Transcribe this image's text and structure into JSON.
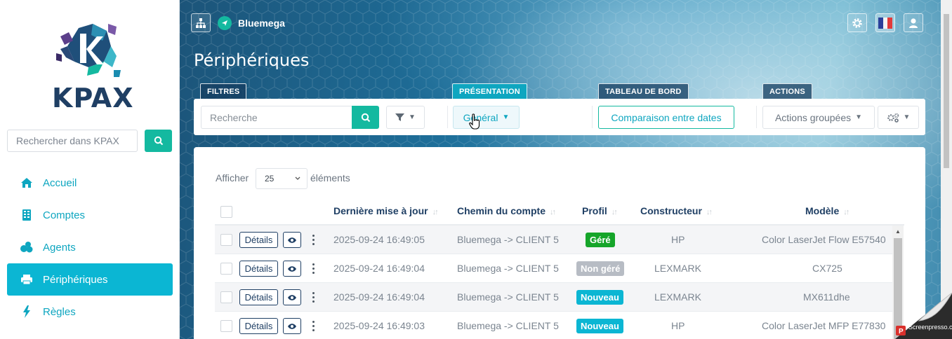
{
  "sidebar": {
    "logo_text": "KPAX",
    "search_placeholder": "Rechercher dans KPAX",
    "items": [
      {
        "label": "Accueil",
        "icon": "home-icon"
      },
      {
        "label": "Comptes",
        "icon": "building-icon"
      },
      {
        "label": "Agents",
        "icon": "agents-icon"
      },
      {
        "label": "Périphériques",
        "icon": "printer-icon",
        "active": true
      },
      {
        "label": "Règles",
        "icon": "bolt-icon"
      }
    ]
  },
  "header": {
    "brand": "Bluemega",
    "title": "Périphériques"
  },
  "sections": {
    "filters": "FILTRES",
    "presentation": "PRÉSENTATION",
    "dashboard": "TABLEAU DE BORD",
    "actions": "ACTIONS"
  },
  "toolbar": {
    "search_placeholder": "Recherche",
    "general_label": "Général",
    "compare_label": "Comparaison entre dates",
    "group_actions_label": "Actions groupées"
  },
  "table": {
    "show_label": "Afficher",
    "page_size": "25",
    "elements_label": "éléments",
    "columns": [
      "Dernière mise à jour",
      "Chemin du compte",
      "Profil",
      "Constructeur",
      "Modèle"
    ],
    "details_label": "Détails",
    "rows": [
      {
        "date": "2025-09-24 16:49:05",
        "path": "Bluemega -> CLIENT 5",
        "profile": "Géré",
        "profile_color": "#16a52a",
        "maker": "HP",
        "model": "Color LaserJet Flow E57540"
      },
      {
        "date": "2025-09-24 16:49:04",
        "path": "Bluemega -> CLIENT 5",
        "profile": "Non géré",
        "profile_color": "#b7bcc4",
        "maker": "LEXMARK",
        "model": "CX725"
      },
      {
        "date": "2025-09-24 16:49:04",
        "path": "Bluemega -> CLIENT 5",
        "profile": "Nouveau",
        "profile_color": "#0bb6d3",
        "maker": "LEXMARK",
        "model": "MX611dhe"
      },
      {
        "date": "2025-09-24 16:49:03",
        "path": "Bluemega -> CLIENT 5",
        "profile": "Nouveau",
        "profile_color": "#0bb6d3",
        "maker": "HP",
        "model": "Color LaserJet MFP E77830"
      }
    ]
  },
  "watermark": "Screenpresso.com",
  "colors": {
    "accent": "#0bb6d3",
    "teal": "#14b9a0",
    "navy": "#1f3f64"
  }
}
